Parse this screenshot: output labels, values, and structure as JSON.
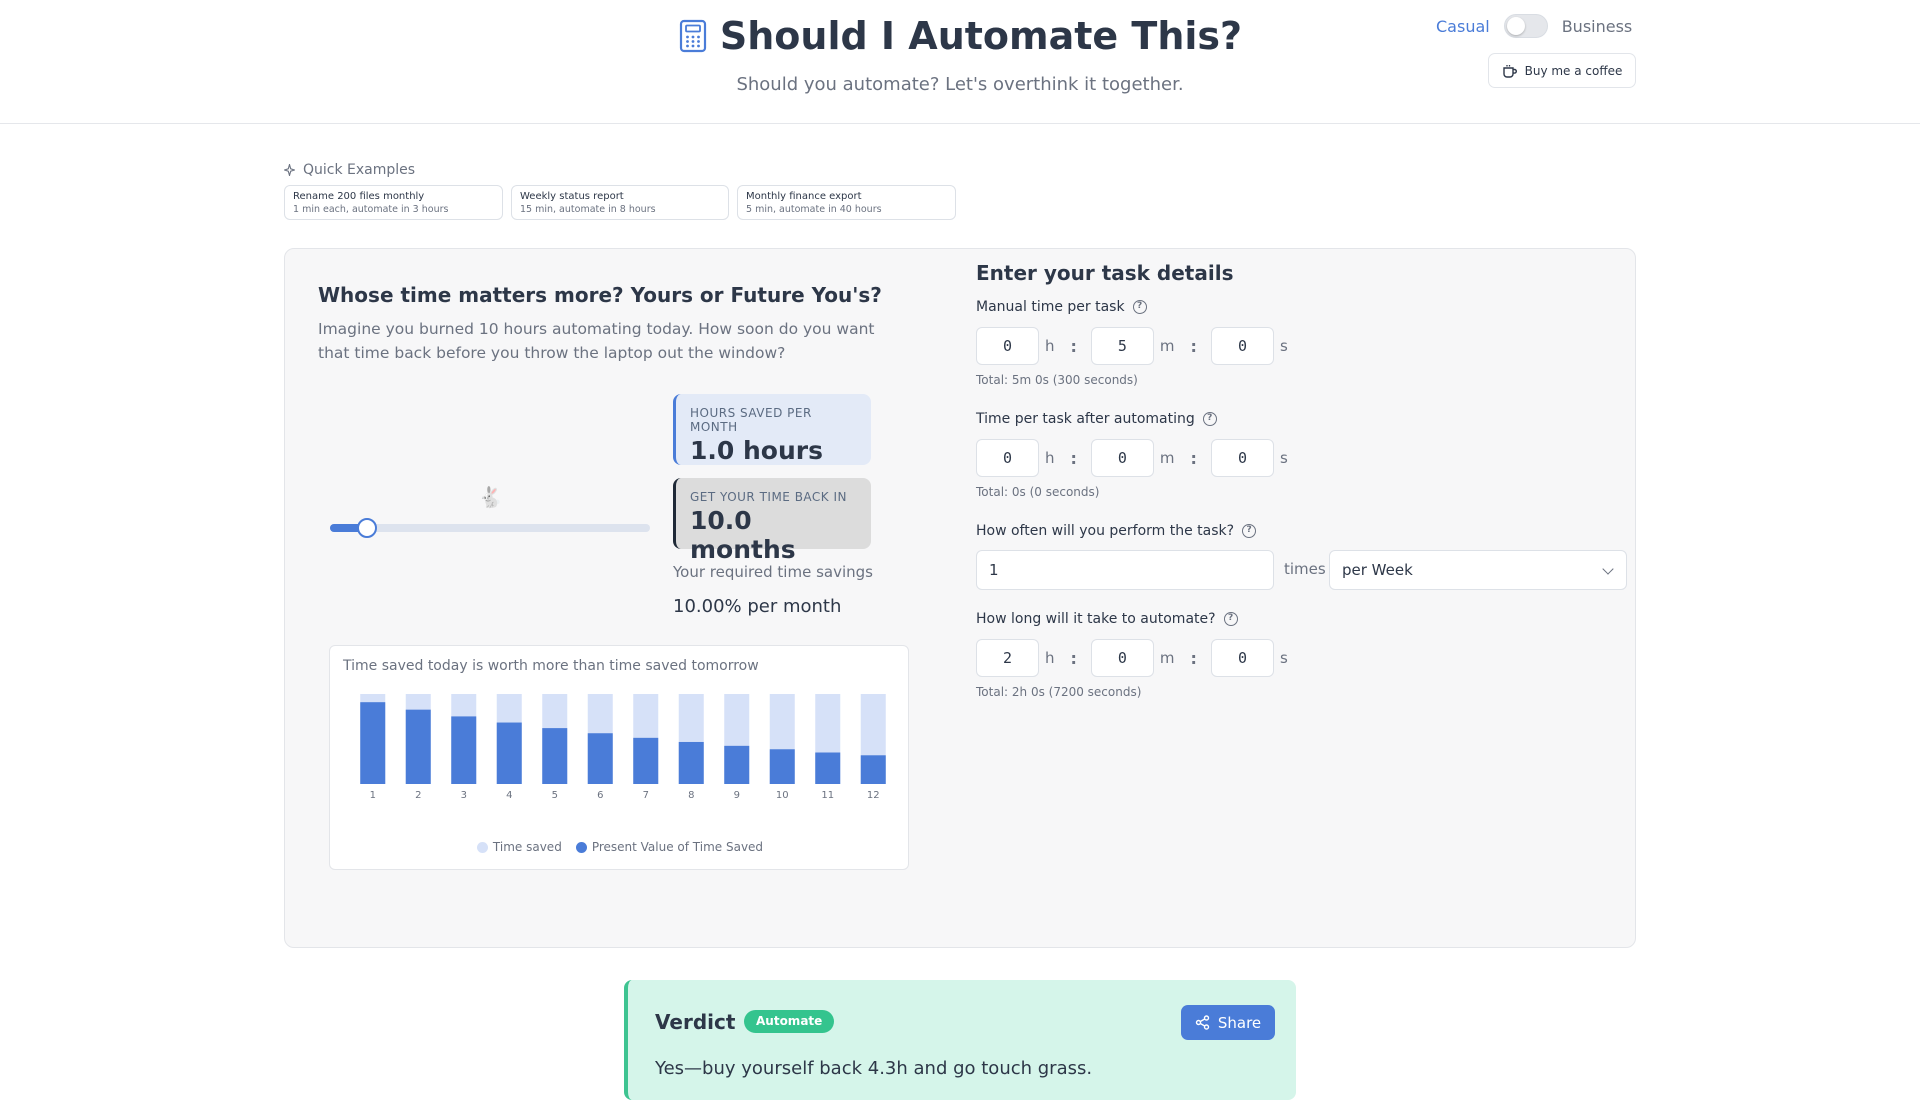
{
  "header": {
    "title": "Should I Automate This?",
    "subtitle": "Should you automate? Let's overthink it together.",
    "mode_casual": "Casual",
    "mode_business": "Business",
    "coffee_label": "Buy me a coffee"
  },
  "quick_examples": {
    "label": "Quick Examples",
    "items": [
      {
        "title": "Rename 200 files monthly",
        "desc": "1 min each, automate in 3 hours"
      },
      {
        "title": "Weekly status report",
        "desc": "15 min, automate in 8 hours"
      },
      {
        "title": "Monthly finance export",
        "desc": "5 min, automate in 40 hours"
      }
    ]
  },
  "left": {
    "title": "Whose time matters more? Yours or Future You's?",
    "desc": "Imagine you burned 10 hours automating today. How soon do you want that time back before you throw the laptop out the window?",
    "slider_emoji": "🐇",
    "slider_fraction": 0.115,
    "hours_label": "HOURS SAVED PER MONTH",
    "hours_value": "1.0 hours",
    "payback_label": "GET YOUR TIME BACK IN",
    "payback_value": "10.0 months",
    "required_label": "Your required time savings",
    "required_value": "10.00% per month"
  },
  "chart_data": {
    "type": "bar",
    "title": "Time saved today is worth more than time saved tomorrow",
    "categories": [
      "1",
      "2",
      "3",
      "4",
      "5",
      "6",
      "7",
      "8",
      "9",
      "10",
      "11",
      "12"
    ],
    "ylim": [
      0,
      1.0
    ],
    "series": [
      {
        "name": "Time saved",
        "color": "#d6e1f8",
        "values": [
          1.0,
          1.0,
          1.0,
          1.0,
          1.0,
          1.0,
          1.0,
          1.0,
          1.0,
          1.0,
          1.0,
          1.0
        ]
      },
      {
        "name": "Present Value of Time Saved",
        "color": "#4a7cd8",
        "values": [
          0.909,
          0.826,
          0.751,
          0.683,
          0.621,
          0.564,
          0.513,
          0.467,
          0.424,
          0.386,
          0.35,
          0.319
        ]
      }
    ]
  },
  "right": {
    "title": "Enter your task details",
    "manual": {
      "label": "Manual time per task",
      "h": "0",
      "m": "5",
      "s": "0",
      "total": "Total: 5m 0s (300 seconds)"
    },
    "after": {
      "label": "Time per task after automating",
      "h": "0",
      "m": "0",
      "s": "0",
      "total": "Total: 0s (0 seconds)"
    },
    "frequency": {
      "label": "How often will you perform the task?",
      "value": "1",
      "times": "times",
      "period": "per Week"
    },
    "automate": {
      "label": "How long will it take to automate?",
      "h": "2",
      "m": "0",
      "s": "0",
      "total": "Total: 2h 0s (7200 seconds)"
    },
    "unit_h": "h",
    "unit_m": "m",
    "unit_s": "s",
    "colon": ":"
  },
  "verdict": {
    "title": "Verdict",
    "badge": "Automate",
    "share": "Share",
    "text": "Yes—buy yourself back 4.3h and go touch grass."
  },
  "colors": {
    "accent": "#4a7cd8",
    "success": "#34c48e",
    "verdict_bg": "#d5f5ea"
  },
  "icons": [
    "calculator-icon",
    "coffee-cup-icon",
    "sparkle-icon",
    "help-circle-icon",
    "chevron-down-icon",
    "share-icon"
  ]
}
